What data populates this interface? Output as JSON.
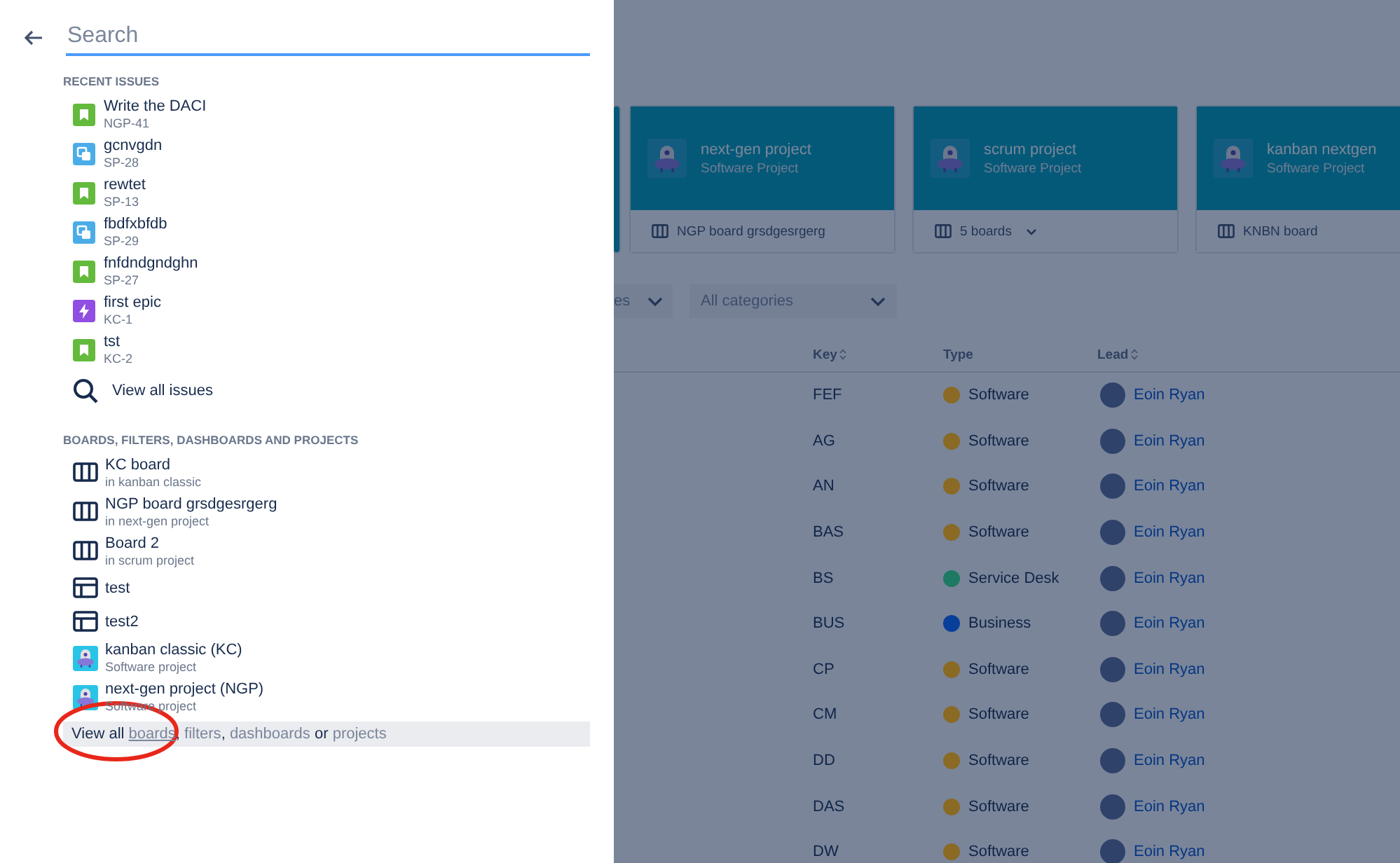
{
  "search": {
    "placeholder": "Search"
  },
  "recent_issues": {
    "heading": "RECENT ISSUES",
    "items": [
      {
        "kind": "story",
        "title": "Write the DACI",
        "key": "NGP-41"
      },
      {
        "kind": "subtask",
        "title": "gcnvgdn",
        "key": "SP-28"
      },
      {
        "kind": "story",
        "title": "rewtet",
        "key": "SP-13"
      },
      {
        "kind": "subtask",
        "title": "fbdfxbfdb",
        "key": "SP-29"
      },
      {
        "kind": "story",
        "title": "fnfdndgndghn",
        "key": "SP-27"
      },
      {
        "kind": "epic",
        "title": "first epic",
        "key": "KC-1"
      },
      {
        "kind": "story",
        "title": "tst",
        "key": "KC-2"
      }
    ],
    "view_all": "View all issues"
  },
  "boards_section": {
    "heading": "BOARDS, FILTERS, DASHBOARDS AND PROJECTS",
    "items": [
      {
        "kind": "board",
        "title": "KC board",
        "subtitle": "in kanban classic"
      },
      {
        "kind": "board",
        "title": "NGP board grsdgesrgerg",
        "subtitle": "in next-gen project"
      },
      {
        "kind": "board",
        "title": "Board 2",
        "subtitle": "in scrum project"
      },
      {
        "kind": "filter",
        "title": "test"
      },
      {
        "kind": "filter",
        "title": "test2"
      },
      {
        "kind": "project",
        "title": "kanban classic (KC)",
        "subtitle": "Software project"
      },
      {
        "kind": "project",
        "title": "next-gen project (NGP)",
        "subtitle": "Software project"
      }
    ]
  },
  "footer": {
    "parts": [
      {
        "kind": "text",
        "text": "View all "
      },
      {
        "kind": "link",
        "text": "boards",
        "hovered": true
      },
      {
        "kind": "text",
        "text": ", "
      },
      {
        "kind": "link",
        "text": "filters",
        "hovered": false
      },
      {
        "kind": "text",
        "text": ", "
      },
      {
        "kind": "link",
        "text": "dashboards",
        "hovered": false
      },
      {
        "kind": "text",
        "text": " or "
      },
      {
        "kind": "link",
        "text": "projects",
        "hovered": false
      }
    ]
  },
  "annotation": {
    "kind": "ellipse"
  },
  "cards": [
    {
      "kind": "cut"
    },
    {
      "kind": "full",
      "title": "next-gen project",
      "subtitle": "Software Project",
      "board": "NGP board grsdgesrgerg",
      "dropdown": false
    },
    {
      "kind": "full",
      "title": "scrum project",
      "subtitle": "Software Project",
      "board": "5 boards",
      "dropdown": true
    },
    {
      "kind": "full",
      "title": "kanban nextgen",
      "subtitle": "Software Project",
      "board": "KNBN board",
      "dropdown": false
    }
  ],
  "filters": [
    {
      "kind": "cut",
      "value": "es"
    },
    {
      "kind": "full",
      "value": "All categories"
    }
  ],
  "table": {
    "columns": [
      {
        "label": "Key",
        "sortable": true
      },
      {
        "label": "Type",
        "sortable": false
      },
      {
        "label": "Lead",
        "sortable": true
      }
    ],
    "rows": [
      {
        "key": "FEF",
        "type": "Software",
        "color": "#8a6a24",
        "lead": "Eoin Ryan"
      },
      {
        "key": "AG",
        "type": "Software",
        "color": "#8a6a24",
        "lead": "Eoin Ryan"
      },
      {
        "key": "AN",
        "type": "Software",
        "color": "#8a6a24",
        "lead": "Eoin Ryan"
      },
      {
        "key": "BAS",
        "type": "Software",
        "color": "#8a6a24",
        "lead": "Eoin Ryan"
      },
      {
        "key": "BS",
        "type": "Service Desk",
        "color": "#1e7a62",
        "lead": "Eoin Ryan"
      },
      {
        "key": "BUS",
        "type": "Business",
        "color": "#083f9a",
        "lead": "Eoin Ryan"
      },
      {
        "key": "CP",
        "type": "Software",
        "color": "#8a6a24",
        "lead": "Eoin Ryan"
      },
      {
        "key": "CM",
        "type": "Software",
        "color": "#8a6a24",
        "lead": "Eoin Ryan"
      },
      {
        "key": "DD",
        "type": "Software",
        "color": "#8a6a24",
        "lead": "Eoin Ryan"
      },
      {
        "key": "DAS",
        "type": "Software",
        "color": "#8a6a24",
        "lead": "Eoin Ryan"
      },
      {
        "key": "DW",
        "type": "Software",
        "color": "#8a6a24",
        "lead": "Eoin Ryan"
      }
    ]
  }
}
